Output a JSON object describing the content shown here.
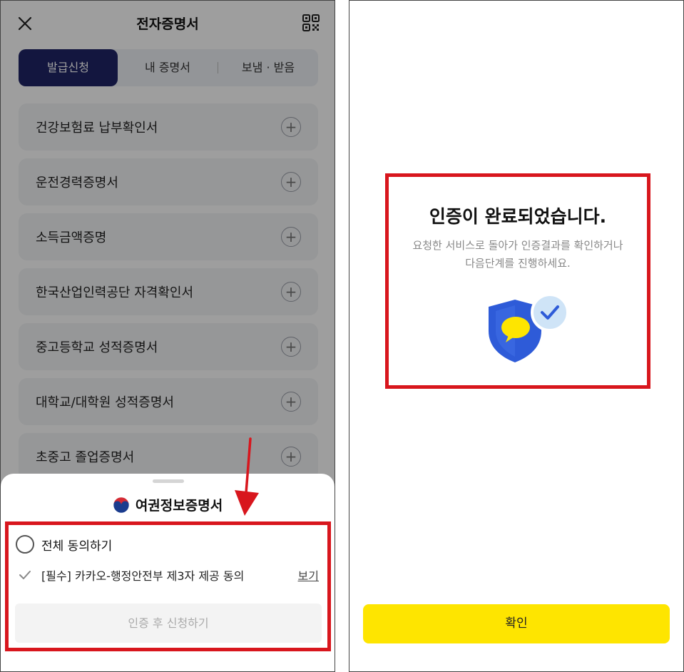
{
  "left": {
    "header": {
      "title": "전자증명서"
    },
    "tabs": [
      {
        "label": "발급신청"
      },
      {
        "label": "내 증명서"
      },
      {
        "label": "보냄 · 받음"
      }
    ],
    "documents": [
      {
        "label": "건강보험료 납부확인서"
      },
      {
        "label": "운전경력증명서"
      },
      {
        "label": "소득금액증명"
      },
      {
        "label": "한국산업인력공단 자격확인서"
      },
      {
        "label": "중고등학교 성적증명서"
      },
      {
        "label": "대학교/대학원 성적증명서"
      },
      {
        "label": "초중고 졸업증명서"
      }
    ],
    "sheet": {
      "title": "여권정보증명서",
      "agree_all": "전체 동의하기",
      "agree_item": "[필수] 카카오-행정안전부 제3자 제공 동의",
      "view_link": "보기",
      "apply_button": "인증 후 신청하기"
    }
  },
  "right": {
    "done_title": "인증이 완료되었습니다.",
    "done_desc_line1": "요청한 서비스로 돌아가 인증결과를 확인하거나",
    "done_desc_line2": "다음단계를 진행하세요.",
    "confirm_button": "확인"
  },
  "colors": {
    "tab_active": "#1f2467",
    "highlight_red": "#d8161d",
    "kakao_yellow": "#fee500",
    "shield_blue": "#2e5bd8"
  }
}
